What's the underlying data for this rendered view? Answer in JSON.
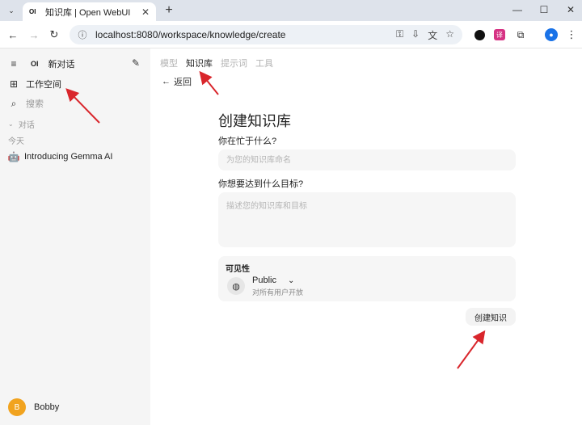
{
  "browser": {
    "tab_title": "知识库 | Open WebUI",
    "tab_favicon": "OI",
    "tab_close": "✕",
    "new_tab": "+",
    "url": "localhost:8080/workspace/knowledge/create"
  },
  "sidebar": {
    "brand": "OI",
    "new_chat": "新对话",
    "workspace": "工作空间",
    "search": "搜索",
    "section_chats": "对话",
    "today": "今天",
    "chat_item": "Introducing Gemma AI",
    "user_initial": "B",
    "user_name": "Bobby"
  },
  "main": {
    "tabs": [
      {
        "label": "模型",
        "active": false
      },
      {
        "label": "知识库",
        "active": true
      },
      {
        "label": "提示词",
        "active": false
      },
      {
        "label": "工具",
        "active": false
      }
    ],
    "back_label": "返回",
    "title": "创建知识库",
    "name_label": "你在忙于什么?",
    "name_placeholder": "为您的知识库命名",
    "desc_label": "你想要达到什么目标?",
    "desc_placeholder": "描述您的知识库和目标",
    "visibility": {
      "title": "可见性",
      "value": "Public",
      "description": "对所有用户开放"
    },
    "create_button": "创建知识"
  },
  "colors": {
    "sidebar_bg": "#f5f5f5",
    "annotation_arrow": "#d9262c",
    "avatar": "#f1a31f"
  }
}
